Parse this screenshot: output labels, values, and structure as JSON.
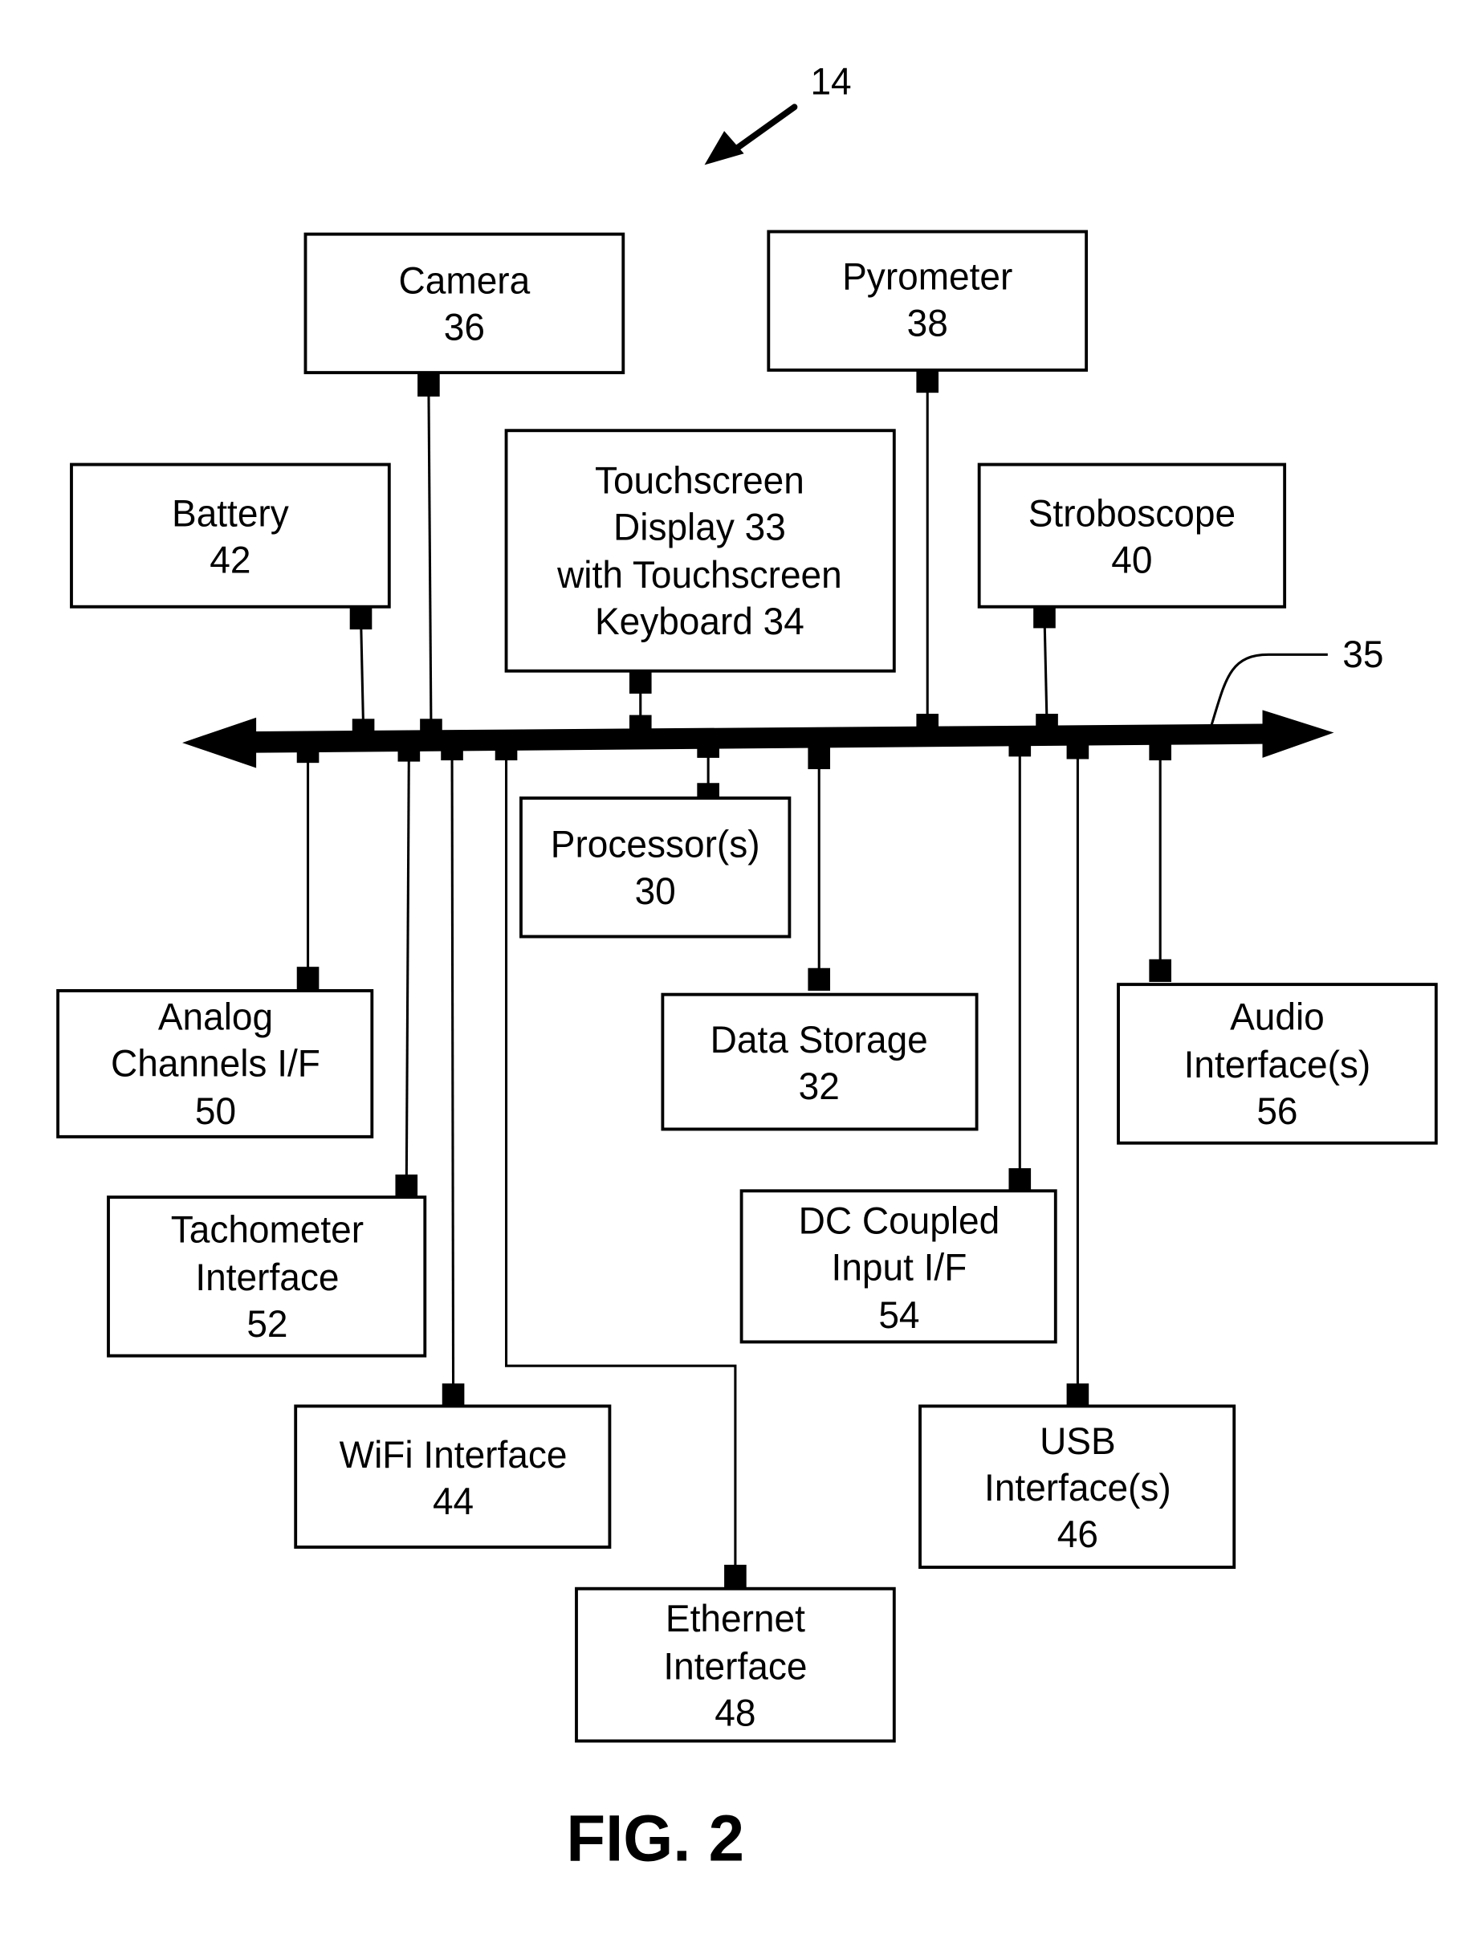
{
  "figure": {
    "caption": "FIG. 2",
    "device_ref": "14",
    "bus_ref": "35"
  },
  "components": [
    {
      "id": "camera",
      "lines": [
        "Camera",
        "36"
      ],
      "side": "top"
    },
    {
      "id": "pyrometer",
      "lines": [
        "Pyrometer",
        "38"
      ],
      "side": "top"
    },
    {
      "id": "battery",
      "lines": [
        "Battery",
        "42"
      ],
      "side": "top"
    },
    {
      "id": "touchscreen",
      "lines": [
        "Touchscreen",
        "Display 33",
        "with Touchscreen",
        "Keyboard 34"
      ],
      "side": "top"
    },
    {
      "id": "stroboscope",
      "lines": [
        "Stroboscope",
        "40"
      ],
      "side": "top"
    },
    {
      "id": "processor",
      "lines": [
        "Processor(s)",
        "30"
      ],
      "side": "bottom"
    },
    {
      "id": "analog",
      "lines": [
        "Analog",
        "Channels I/F",
        "50"
      ],
      "side": "bottom"
    },
    {
      "id": "datastorage",
      "lines": [
        "Data Storage",
        "32"
      ],
      "side": "bottom"
    },
    {
      "id": "audio",
      "lines": [
        "Audio",
        "Interface(s)",
        "56"
      ],
      "side": "bottom"
    },
    {
      "id": "tachometer",
      "lines": [
        "Tachometer",
        "Interface",
        "52"
      ],
      "side": "bottom"
    },
    {
      "id": "dccoupled",
      "lines": [
        "DC Coupled",
        "Input I/F",
        "54"
      ],
      "side": "bottom"
    },
    {
      "id": "wifi",
      "lines": [
        "WiFi Interface",
        "44"
      ],
      "side": "bottom"
    },
    {
      "id": "usb",
      "lines": [
        "USB",
        "Interface(s)",
        "46"
      ],
      "side": "bottom"
    },
    {
      "id": "ethernet",
      "lines": [
        "Ethernet",
        "Interface",
        "48"
      ],
      "side": "bottom"
    }
  ]
}
